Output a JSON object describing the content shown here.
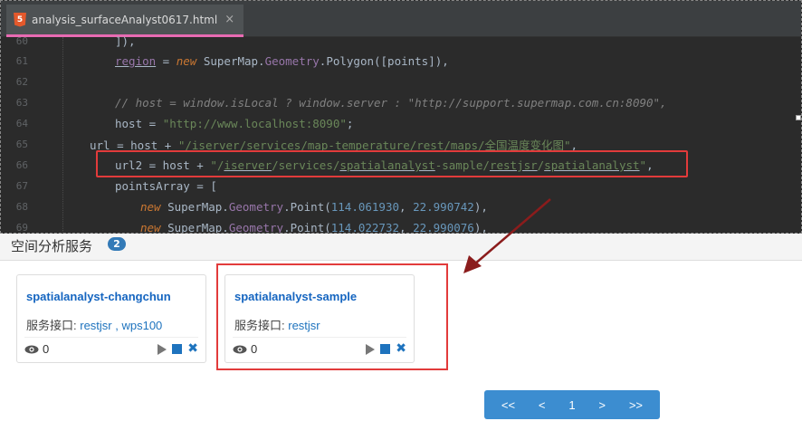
{
  "editor": {
    "tab_label": "analysis_surfaceAnalyst0617.html",
    "tab_close": "×",
    "tab_icon": "5",
    "lines": [
      {
        "num": "60",
        "text": "]),"
      },
      {
        "num": "61",
        "text": "region = new SuperMap.Geometry.Polygon([points]),"
      },
      {
        "num": "62",
        "text": ""
      },
      {
        "num": "63",
        "text": "// host = window.isLocal ? window.server : \"http://support.supermap.com.cn:8090\","
      },
      {
        "num": "64",
        "text": "host = \"http://www.localhost:8090\";"
      },
      {
        "num": "65",
        "text": "url = host + \"/iserver/services/map-temperature/rest/maps/全国温度变化图\","
      },
      {
        "num": "66",
        "text": "url2 = host + \"/iserver/services/spatialanalyst-sample/restjsr/spatialanalyst\","
      },
      {
        "num": "67",
        "text": "pointsArray = ["
      },
      {
        "num": "68",
        "text": "new SuperMap.Geometry.Point(114.061930, 22.990742),"
      },
      {
        "num": "69",
        "text": "new SuperMap.Geometry.Point(114.022732, 22.990076),"
      }
    ]
  },
  "panel": {
    "title": "空间分析服务",
    "count": "2",
    "cards": [
      {
        "title": "spatialanalyst-changchun",
        "iface_label": "服务接口:",
        "iface_links": "restjsr , wps100",
        "views": "0"
      },
      {
        "title": "spatialanalyst-sample",
        "iface_label": "服务接口:",
        "iface_links": "restjsr",
        "views": "0"
      }
    ]
  },
  "pager": {
    "first": "<<",
    "prev": "<",
    "current": "1",
    "next": ">",
    "last": ">>"
  },
  "colors": {
    "highlight": "#e23b3b",
    "link": "#1e73be",
    "pager": "#3c8dd0",
    "badge": "#337ab7"
  }
}
